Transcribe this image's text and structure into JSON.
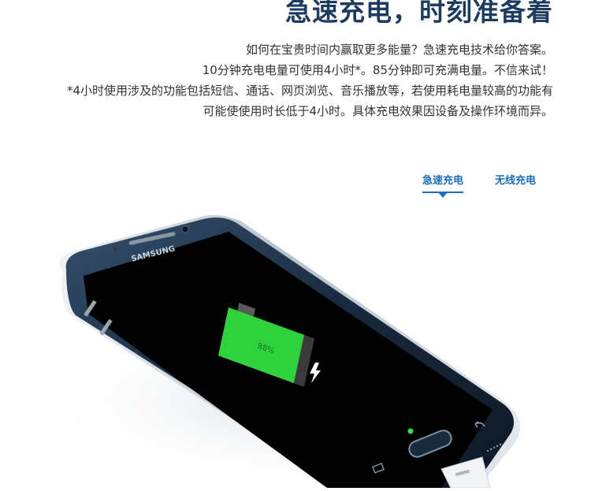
{
  "header": {
    "title": "急速充电，时刻准备着"
  },
  "description": {
    "line1": "如何在宝贵时间内赢取更多能量？急速充电技术给你答案。",
    "line2": "10分钟充电电量可使用4小时*。85分钟即可充满电量。不信来试！",
    "line3": "*4小时使用涉及的功能包括短信、通话、网页浏览、音乐播放等，若使用耗电量较高的功能有",
    "line4": "可能使使用时长低于4小时。具体充电效果因设备及操作环境而异。"
  },
  "tabs": [
    {
      "label": "急速充电",
      "active": true
    },
    {
      "label": "无线充电",
      "active": false
    }
  ],
  "phone": {
    "brand": "SAMSUNG",
    "battery_text": "88%",
    "battery_level": 0.88
  },
  "colors": {
    "headline": "#1d3a5f",
    "tab_accent": "#1b6fb9",
    "battery_green": "#2fd13d",
    "phone_frame": "#1f3550"
  }
}
